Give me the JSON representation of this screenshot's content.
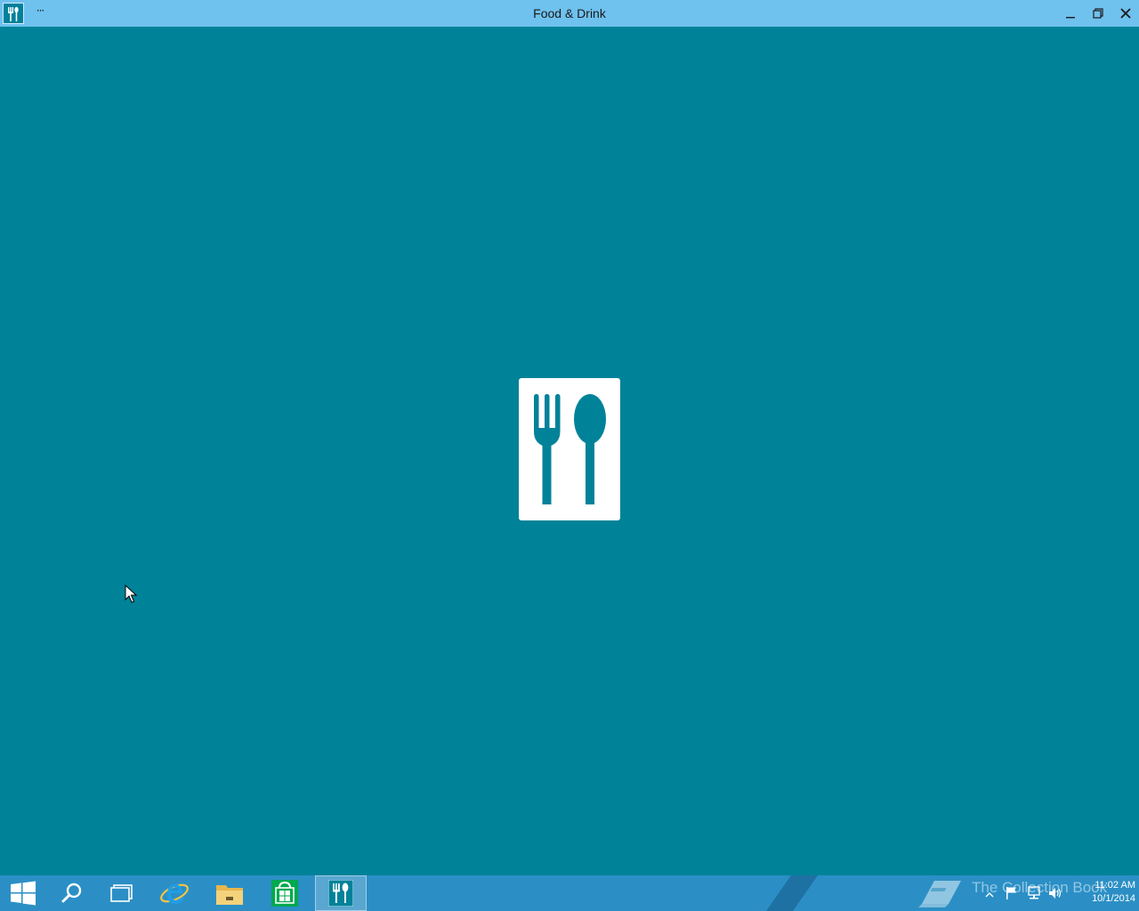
{
  "window": {
    "title": "Food & Drink",
    "more_label": "···"
  },
  "colors": {
    "background": "#008299",
    "titlebar": "#6fc1ee",
    "taskbar": "#2b8fc5",
    "logo": "#ffffff"
  },
  "icons": {
    "app": "fork-spoon-icon",
    "minimize": "minimize-icon",
    "maximize": "restore-icon",
    "close": "close-icon",
    "splash": "fork-spoon-icon"
  },
  "taskbar": {
    "items": [
      {
        "name": "start-button",
        "icon": "windows-logo-icon"
      },
      {
        "name": "search-button",
        "icon": "search-icon"
      },
      {
        "name": "task-view-button",
        "icon": "task-view-icon"
      },
      {
        "name": "internet-explorer-button",
        "icon": "ie-icon"
      },
      {
        "name": "file-explorer-button",
        "icon": "folder-icon"
      },
      {
        "name": "store-button",
        "icon": "store-icon"
      },
      {
        "name": "food-drink-button",
        "icon": "fork-spoon-icon",
        "active": true
      }
    ],
    "tray": {
      "watermark": "The Collection Book",
      "time": "11:02 AM",
      "date": "10/1/2014"
    }
  }
}
